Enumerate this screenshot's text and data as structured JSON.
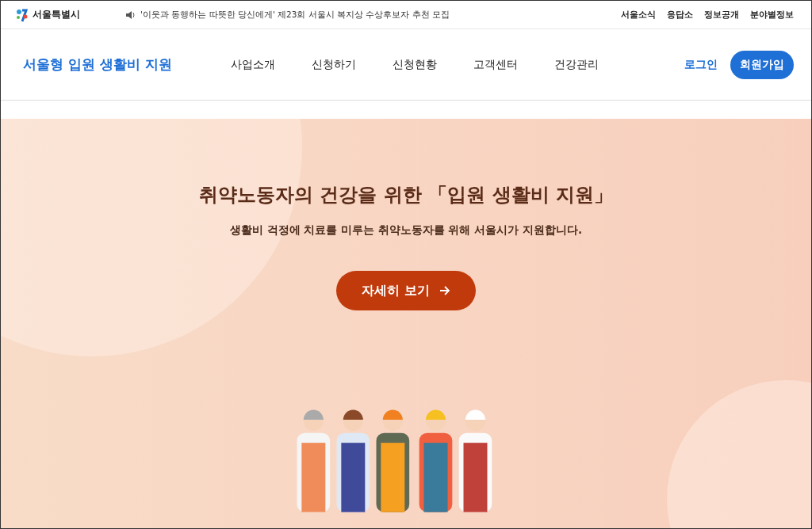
{
  "top_bar": {
    "logo": "서울특별시",
    "notice": "'이웃과 동행하는 따뜻한 당신에게' 제23회 서울시 복지상 수상후보자 추천 모집",
    "links": [
      "서울소식",
      "응답소",
      "정보공개",
      "분야별정보"
    ]
  },
  "header": {
    "title": "서울형 입원 생활비 지원",
    "nav": [
      "사업소개",
      "신청하기",
      "신청현황",
      "고객센터",
      "건강관리"
    ],
    "login": "로그인",
    "signup": "회원가입"
  },
  "hero": {
    "title": "취약노동자의 건강을 위한 「입원 생활비 지원」",
    "subtitle": "생활비 걱정에 치료를 미루는 취약노동자를 위해 서울시가 지원합니다.",
    "button": "자세히 보기"
  }
}
